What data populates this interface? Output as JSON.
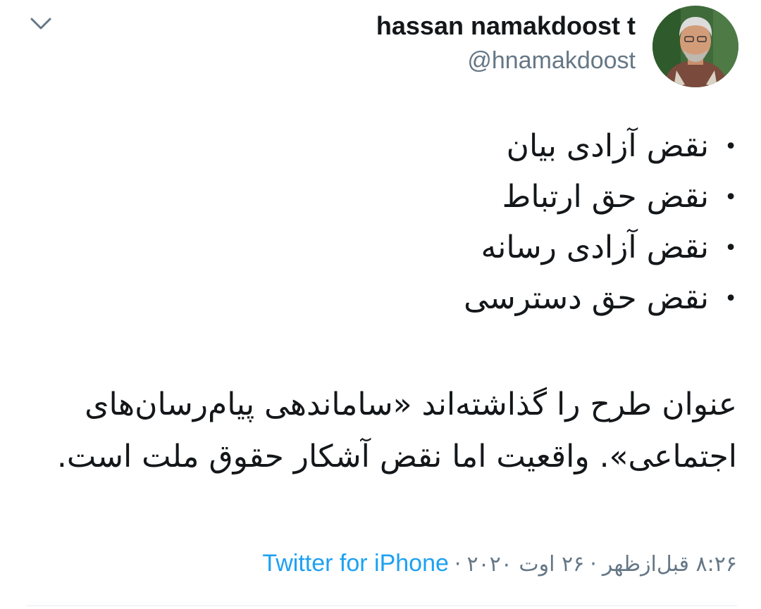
{
  "header": {
    "display_name": "hassan namakdoost t",
    "handle": "@hnamakdoost",
    "menu_icon": "chevron-down-icon",
    "avatar_icon": "user-avatar"
  },
  "tweet": {
    "bullets": [
      "نقض آزادی بیان",
      "نقض حق ارتباط",
      "نقض آزادی رسانه",
      "نقض حق دسترسی"
    ],
    "bullet_glyph": "•",
    "paragraph": "عنوان طرح را گذاشته‌اند «ساماندهی پیام‌رسان‌های اجتماعی». واقعیت اما نقض آشکار حقوق ملت است."
  },
  "meta": {
    "time": "۸:۲۶ قبل‌ازظهر",
    "date": "۲۶ اوت ۲۰۲۰",
    "separator": "·",
    "source": "Twitter for iPhone"
  },
  "colors": {
    "text": "#14171a",
    "secondary": "#657786",
    "link": "#1da1f2",
    "divider": "#e6ecf0"
  }
}
